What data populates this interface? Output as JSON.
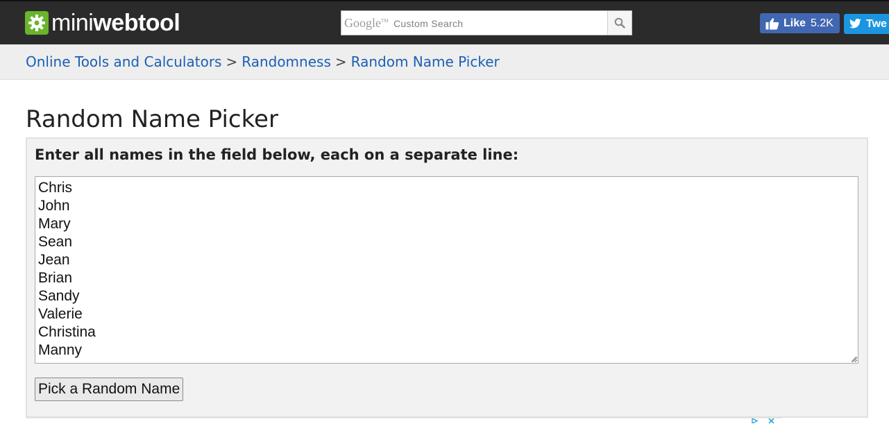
{
  "header": {
    "logo": {
      "thin": "mini",
      "bold": "webtool"
    },
    "search": {
      "brand": "Google",
      "brand_tm": "TM",
      "label": "Custom Search",
      "value": ""
    },
    "facebook": {
      "label": "Like",
      "count": "5.2K"
    },
    "twitter": {
      "label": "Twe"
    }
  },
  "breadcrumb": {
    "items": [
      "Online Tools and Calculators",
      "Randomness",
      "Random Name Picker"
    ],
    "separator": ">"
  },
  "page": {
    "title": "Random Name Picker"
  },
  "tool": {
    "instruction": "Enter all names in the field below, each on a separate line:",
    "names": [
      "Chris",
      "John",
      "Mary",
      "Sean",
      "Jean",
      "Brian",
      "Sandy",
      "Valerie",
      "Christina",
      "Manny"
    ],
    "button_label": "Pick a Random Name"
  },
  "colors": {
    "header_bg": "#2b2b2b",
    "logo_green": "#6ab42d",
    "link_blue": "#1a5fb4",
    "facebook_blue": "#4267b2",
    "twitter_blue": "#1b95e0",
    "crumb_bg": "#eeeeee",
    "panel_bg": "#f2f2f2"
  },
  "icons": [
    "gear-icon",
    "search-icon",
    "thumbs-up-icon",
    "twitter-bird-icon",
    "resize-grip-icon",
    "ad-choices-icon"
  ]
}
